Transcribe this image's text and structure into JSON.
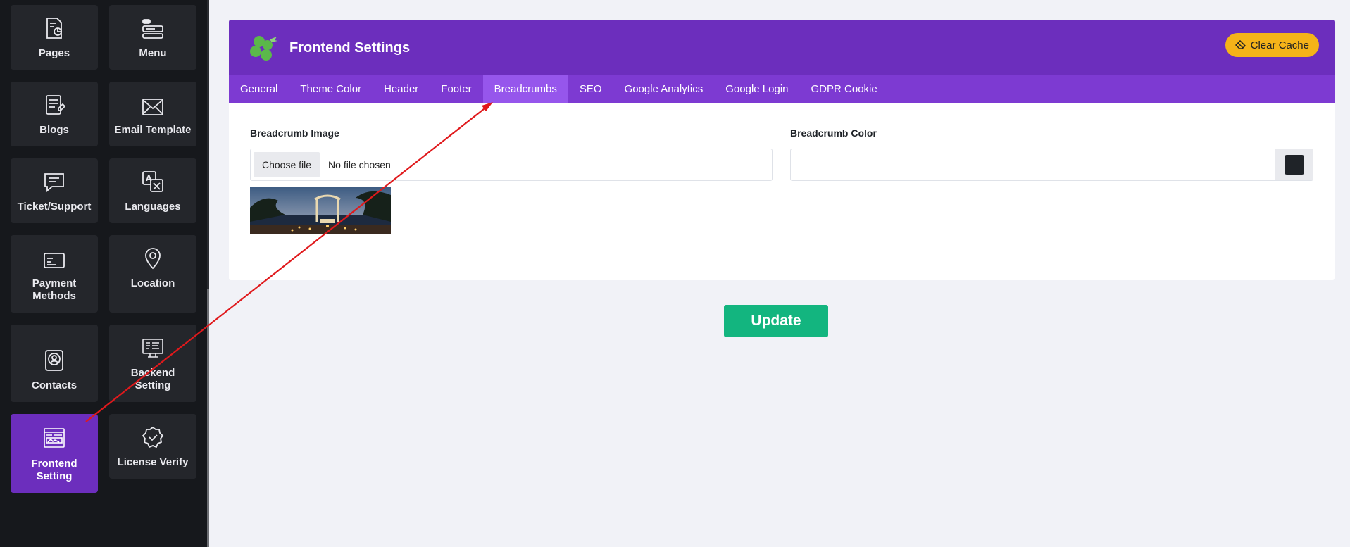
{
  "sidebar": {
    "tiles": [
      {
        "label": "Pages",
        "icon": "pages-icon"
      },
      {
        "label": "Menu",
        "icon": "menu-icon"
      },
      {
        "label": "Blogs",
        "icon": "blogs-icon"
      },
      {
        "label": "Email Template",
        "icon": "envelope-icon"
      },
      {
        "label": "Ticket/Support",
        "icon": "chat-icon"
      },
      {
        "label": "Languages",
        "icon": "translate-icon"
      },
      {
        "label": "Payment Methods",
        "icon": "payment-card-icon"
      },
      {
        "label": "Location",
        "icon": "location-pin-icon"
      },
      {
        "label": "Contacts",
        "icon": "contacts-icon"
      },
      {
        "label": "Backend Setting",
        "icon": "backend-monitor-icon"
      },
      {
        "label": "Frontend Setting",
        "icon": "frontend-layout-icon"
      },
      {
        "label": "License Verify",
        "icon": "badge-check-icon"
      }
    ],
    "active": "Frontend Setting"
  },
  "header": {
    "title": "Frontend Settings",
    "clear_cache": "Clear Cache"
  },
  "tabs": [
    "General",
    "Theme Color",
    "Header",
    "Footer",
    "Breadcrumbs",
    "SEO",
    "Google Analytics",
    "Google Login",
    "GDPR Cookie"
  ],
  "active_tab": "Breadcrumbs",
  "form": {
    "image_label": "Breadcrumb Image",
    "choose_file": "Choose file",
    "no_file": "No file chosen",
    "color_label": "Breadcrumb Color",
    "color_value": "#1f2328"
  },
  "update_label": "Update",
  "colors": {
    "primary": "#6c2ebd",
    "tabbar": "#7d3ad2",
    "tab_active": "#9656ec",
    "warning": "#f5b319",
    "success": "#13b57f",
    "sidebar_bg": "#16181c",
    "annotation_arrow": "#e0191c"
  }
}
